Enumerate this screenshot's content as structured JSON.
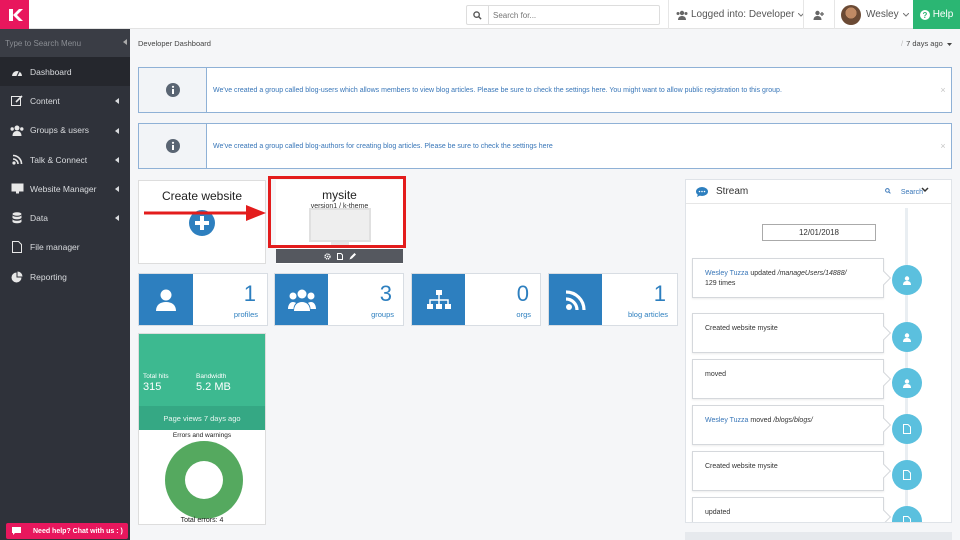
{
  "top": {
    "search_placeholder": "Search for...",
    "logged_in": "Logged into: Developer",
    "user_name": "Wesley",
    "help_label": "Help"
  },
  "sidebar": {
    "search_placeholder": "Type to Search Menu",
    "items": [
      {
        "label": "Dashboard",
        "icon": "dashboard-icon",
        "has_submenu": false,
        "active": true
      },
      {
        "label": "Content",
        "icon": "edit-icon",
        "has_submenu": true
      },
      {
        "label": "Groups & users",
        "icon": "users-icon",
        "has_submenu": true
      },
      {
        "label": "Talk & Connect",
        "icon": "rss-icon",
        "has_submenu": true
      },
      {
        "label": "Website Manager",
        "icon": "desktop-icon",
        "has_submenu": true
      },
      {
        "label": "Data",
        "icon": "database-icon",
        "has_submenu": true
      },
      {
        "label": "File manager",
        "icon": "file-icon",
        "has_submenu": false
      },
      {
        "label": "Reporting",
        "icon": "pie-chart-icon",
        "has_submenu": false
      }
    ],
    "chat_label": "Need help? Chat with us : )"
  },
  "page": {
    "breadcrumb": "Developer Dashboard",
    "time_range": "7 days ago"
  },
  "alerts": [
    {
      "text": "We've created a group called blog-users which allows members to view blog articles. Please be sure to check the settings here. You might want to allow public registration to this group.",
      "close": "×"
    },
    {
      "text": "We've created a group called blog-authors for creating blog articles. Please be sure to check the settings here",
      "close": "×"
    }
  ],
  "create_website": {
    "label": "Create website"
  },
  "site": {
    "name": "mysite",
    "subtitle": "version1 / k-theme"
  },
  "stats": [
    {
      "value": "1",
      "label": "profiles",
      "icon": "user-icon"
    },
    {
      "value": "3",
      "label": "groups",
      "icon": "group-icon"
    },
    {
      "value": "0",
      "label": "orgs",
      "icon": "org-chart-icon"
    },
    {
      "value": "1",
      "label": "blog articles",
      "icon": "rss-icon"
    }
  ],
  "metrics": {
    "hits_label": "Total hits",
    "hits_value": "315",
    "bandwidth_label": "Bandwidth",
    "bandwidth_value": "5.2 MB",
    "views_label": "Page views 7 days ago",
    "errors_title": "Errors and warnings",
    "errors_total": "Total errors: 4"
  },
  "stream": {
    "title": "Stream",
    "search_label": "Search",
    "date": "12/01/2018",
    "events": [
      {
        "user": "Wesley Tuzza",
        "verb": " updated ",
        "target": "/manageUsers/14888/",
        "suffix": "129 times",
        "icon": "user-icon"
      },
      {
        "user": "",
        "verb": "Created website mysite",
        "target": "",
        "suffix": "",
        "icon": "user-icon"
      },
      {
        "user": "",
        "verb": "moved",
        "target": "",
        "suffix": "",
        "icon": "user-icon"
      },
      {
        "user": "Wesley Tuzza",
        "verb": " moved ",
        "target": "/blogs/blogs/",
        "suffix": "",
        "icon": "document-icon"
      },
      {
        "user": "",
        "verb": "Created website mysite",
        "target": "",
        "suffix": "",
        "icon": "document-icon"
      },
      {
        "user": "",
        "verb": "updated",
        "target": "",
        "suffix": "",
        "icon": "document-icon"
      }
    ]
  }
}
